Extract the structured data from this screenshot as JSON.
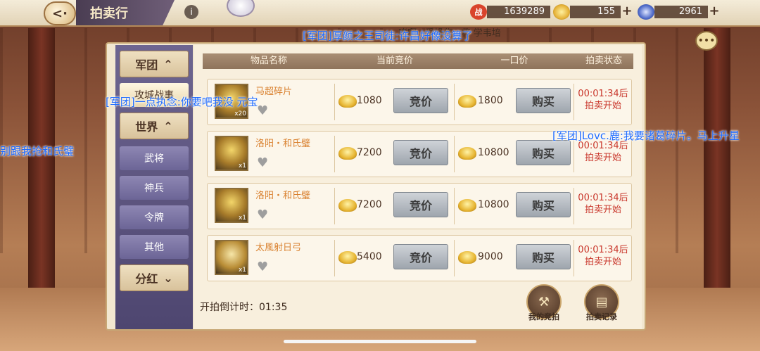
{
  "header": {
    "title": "拍卖行",
    "info_glyph": "i",
    "back_glyph": "<·"
  },
  "currencies": [
    {
      "icon": "power-icon",
      "glyph": "战",
      "value": "1639289",
      "color": "#d9442c"
    },
    {
      "icon": "gold-ingot-icon",
      "glyph": "",
      "value": "155",
      "color": "#e6b33a"
    },
    {
      "icon": "silver-coin-icon",
      "glyph": "",
      "value": "2961",
      "color": "#4f6bc9"
    }
  ],
  "plus_glyph": "+",
  "scroll_text": "嗜啊 . 受操作 . 将 学韦培",
  "sidebar": {
    "items": [
      {
        "label": "军团",
        "arrow": "⌃",
        "kind": "major"
      },
      {
        "label": "攻城战事",
        "arrow": "",
        "kind": "active"
      },
      {
        "label": "世界",
        "arrow": "⌃",
        "kind": "major"
      },
      {
        "label": "武将",
        "arrow": "",
        "kind": "minor"
      },
      {
        "label": "神兵",
        "arrow": "",
        "kind": "minor"
      },
      {
        "label": "令牌",
        "arrow": "",
        "kind": "minor"
      },
      {
        "label": "其他",
        "arrow": "",
        "kind": "minor"
      },
      {
        "label": "分红",
        "arrow": "⌄",
        "kind": "major"
      }
    ]
  },
  "table": {
    "headers": [
      "物品名称",
      "当前竞价",
      "一口价",
      "拍卖状态"
    ],
    "rows": [
      {
        "name": "马超碎片",
        "count": "x20",
        "bid": "1080",
        "buyout": "1800",
        "status_time": "00:01:34后",
        "status_text": "拍卖开始"
      },
      {
        "name": "洛阳・和氏璧",
        "count": "x1",
        "bid": "7200",
        "buyout": "10800",
        "status_time": "00:01:34后",
        "status_text": "拍卖开始"
      },
      {
        "name": "洛阳・和氏璧",
        "count": "x1",
        "bid": "7200",
        "buyout": "10800",
        "status_time": "00:01:34后",
        "status_text": "拍卖开始"
      },
      {
        "name": "太風射日弓",
        "count": "x1",
        "bid": "5400",
        "buyout": "9000",
        "status_time": "00:01:34后",
        "status_text": "拍卖开始"
      }
    ],
    "bid_button": "竞价",
    "buy_button": "购买",
    "favorite_glyph": "♥"
  },
  "footer": {
    "countdown_label": "开拍倒计时：",
    "countdown_value": "01:35",
    "my_bids_label": "我的竞拍",
    "records_label": "拍卖记录"
  },
  "chat": [
    "[军团]厚颜之王司徒:许昌好像没算了",
    "[军团]一点执念:你要吧我没 元宝",
    "[军团]Lovc.鹿:我要诸葛碎片。马上升星",
    "别跟我抢和氏璧"
  ],
  "chat_glyph": "•••"
}
